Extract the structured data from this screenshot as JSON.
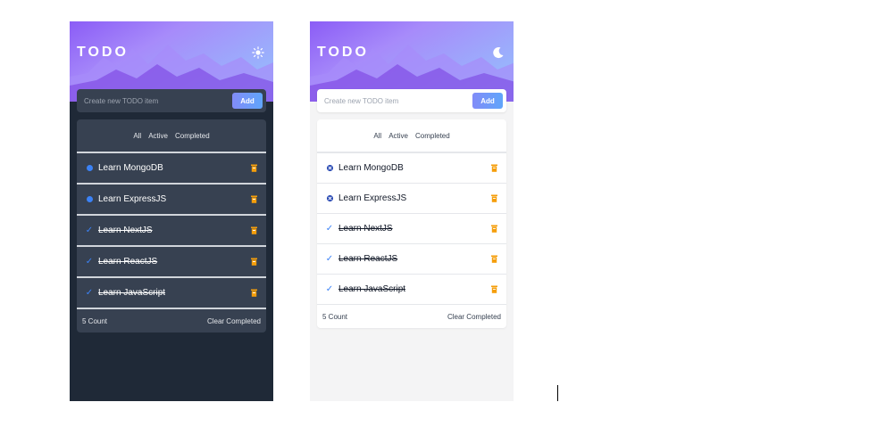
{
  "colors": {
    "dark_bg": "#1f2937",
    "dark_card": "#374151",
    "light_bg": "#f4f4f5",
    "accent": "#3b82f6",
    "trash": "#f59e0b",
    "add_gradient": [
      "#818cf8",
      "#60a5fa"
    ]
  },
  "dark": {
    "title": "TODO",
    "mode_icon": "sun-icon",
    "input_placeholder": "Create new TODO item",
    "add_label": "Add",
    "filters": {
      "all": "All",
      "active": "Active",
      "completed": "Completed"
    },
    "items": [
      {
        "text": "Learn MongoDB",
        "completed": false
      },
      {
        "text": "Learn ExpressJS",
        "completed": false
      },
      {
        "text": "Learn NextJS",
        "completed": true
      },
      {
        "text": "Learn ReactJS",
        "completed": true
      },
      {
        "text": "Learn JavaScript",
        "completed": true
      }
    ],
    "count": "5 Count",
    "clear_label": "Clear Completed"
  },
  "light": {
    "title": "TODO",
    "mode_icon": "moon-icon",
    "input_placeholder": "Create new TODO item",
    "add_label": "Add",
    "filters": {
      "all": "All",
      "active": "Active",
      "completed": "Completed"
    },
    "items": [
      {
        "text": "Learn MongoDB",
        "completed": false
      },
      {
        "text": "Learn ExpressJS",
        "completed": false
      },
      {
        "text": "Learn NextJS",
        "completed": true
      },
      {
        "text": "Learn ReactJS",
        "completed": true
      },
      {
        "text": "Learn JavaScript",
        "completed": true
      }
    ],
    "count": "5 Count",
    "clear_label": "Clear Completed"
  }
}
